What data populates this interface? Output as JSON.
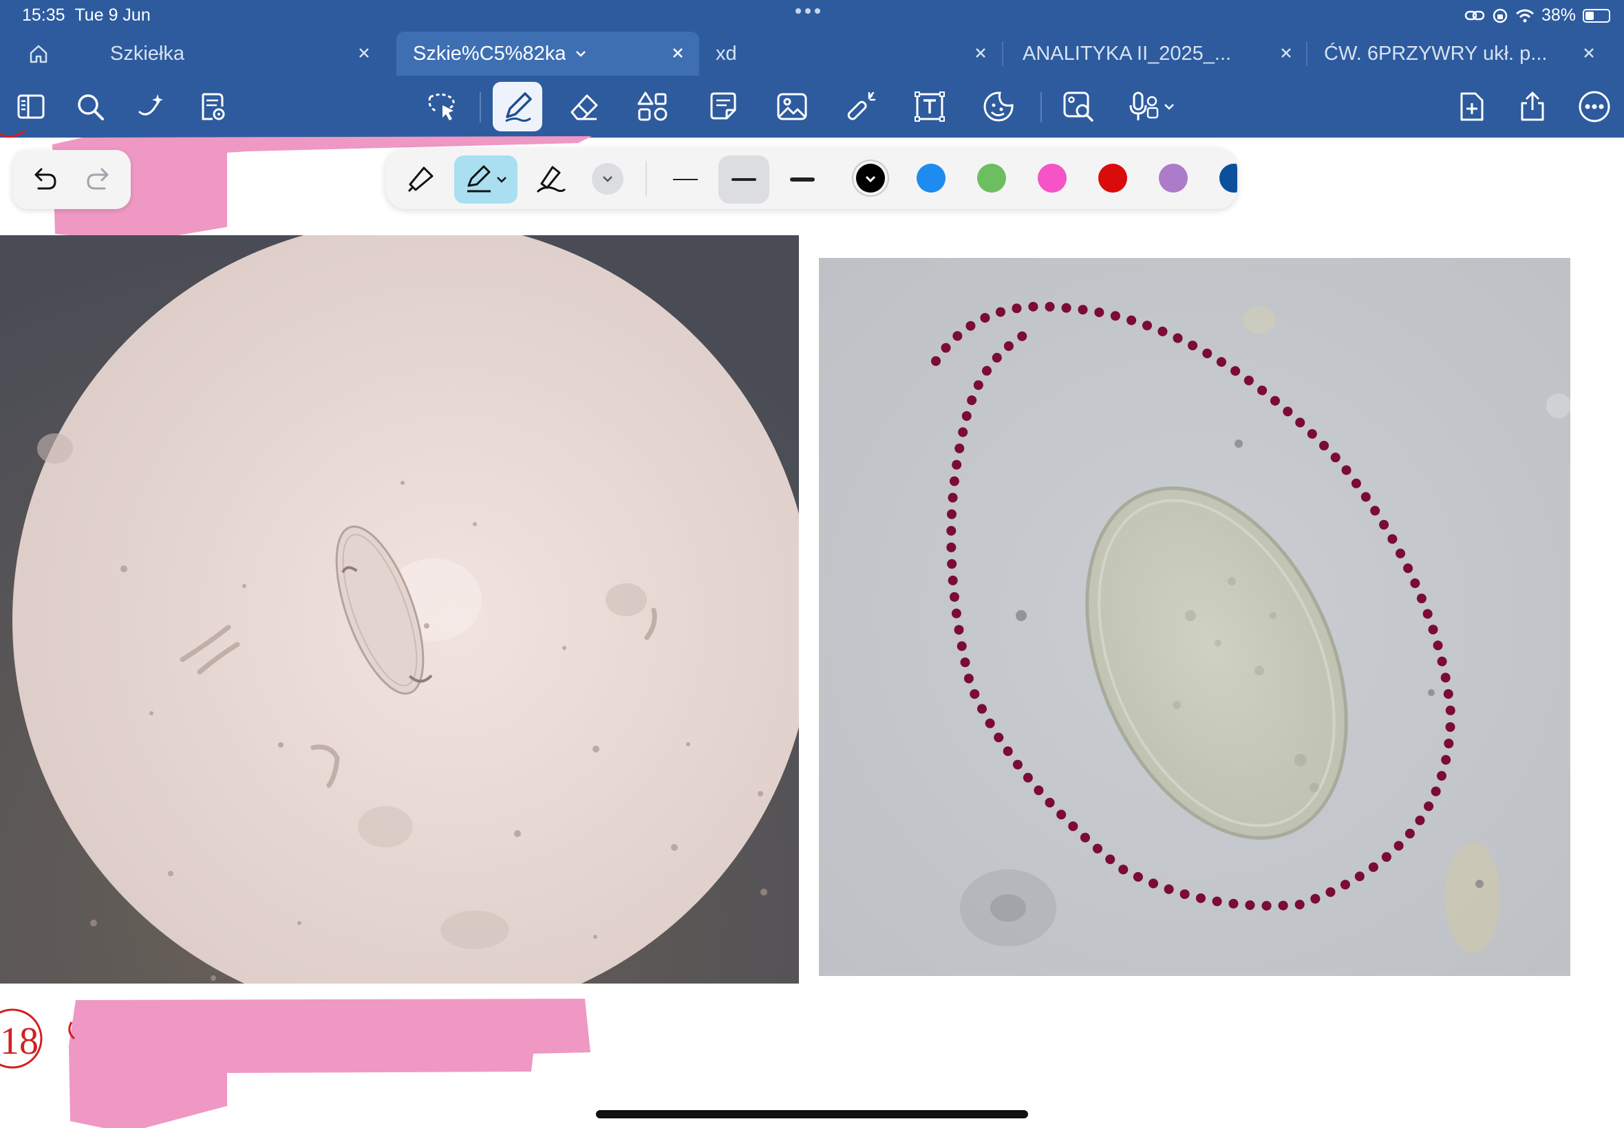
{
  "status_bar": {
    "time": "15:35",
    "date": "Tue 9 Jun",
    "battery": "38%",
    "battery_level": 0.38
  },
  "tabs": [
    {
      "label": "Szkiełka",
      "active": false
    },
    {
      "label": "Szkie%C5%82ka",
      "active": true
    },
    {
      "label": "xd",
      "active": false
    },
    {
      "label": "ANALITYKA II_2025_...",
      "active": false
    },
    {
      "label": "ĆW. 6PRZYWRY ukł. p...",
      "active": false
    }
  ],
  "toolbar": {
    "left_tools": [
      "sidebar-icon",
      "search-icon",
      "ai-assist-icon",
      "document-view-icon"
    ],
    "center_tools": [
      "lasso-icon",
      "pen-icon",
      "eraser-icon",
      "shapes-icon",
      "sticky-note-icon",
      "image-icon",
      "laser-pointer-icon",
      "text-box-icon",
      "sticker-icon",
      "image-search-icon",
      "microphone-icon"
    ],
    "right_tools": [
      "add-page-icon",
      "share-icon",
      "more-icon"
    ],
    "active_tool": "pen-icon"
  },
  "pen_panel": {
    "tools": [
      "fountain-pen-icon",
      "ballpoint-pen-icon",
      "brush-pen-icon"
    ],
    "active_tool": "ballpoint-pen-icon",
    "stroke_widths": [
      "thin",
      "medium",
      "thick"
    ],
    "active_width": "medium",
    "colors": [
      "#000000",
      "#1d8bf0",
      "#6cbf5f",
      "#f553c6",
      "#d90b0b",
      "#ac7bc9",
      "#0c4f9c"
    ],
    "selected_color": "#000000"
  },
  "colors": {
    "app_bar": "#2d5b9e",
    "active_tab": "#3e6fb3",
    "highlight_pink": "#ef98c4",
    "ink_red": "#d12020",
    "dotted_ink": "#7b0c33"
  },
  "annotations": {
    "page_number_circle": "18"
  }
}
